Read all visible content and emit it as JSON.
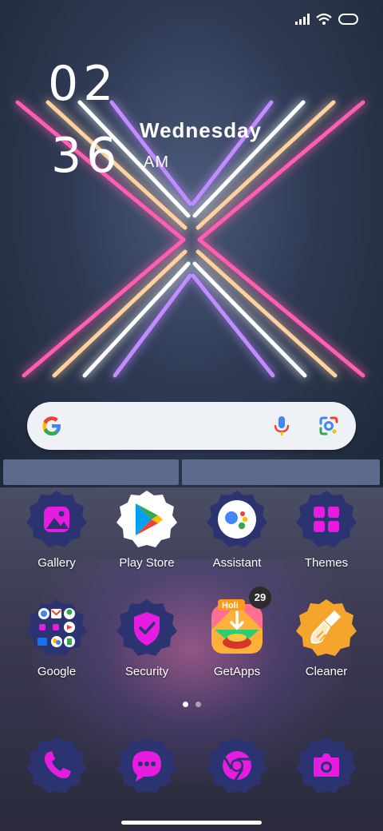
{
  "status_bar": {
    "icons": [
      "signal-icon",
      "wifi-icon",
      "battery-icon"
    ]
  },
  "clock": {
    "hour": "02",
    "minute": "36",
    "day": "Wednesday",
    "ampm": "AM"
  },
  "search": {
    "logo": "google-g-icon",
    "mic": "mic-icon",
    "lens": "google-lens-icon"
  },
  "apps": [
    {
      "label": "Gallery",
      "icon": "gallery-icon"
    },
    {
      "label": "Play Store",
      "icon": "play-store-icon"
    },
    {
      "label": "Assistant",
      "icon": "assistant-icon"
    },
    {
      "label": "Themes",
      "icon": "themes-icon"
    },
    {
      "label": "Google",
      "icon": "google-folder-icon"
    },
    {
      "label": "Security",
      "icon": "security-icon"
    },
    {
      "label": "GetApps",
      "icon": "getapps-icon",
      "badge": "29"
    },
    {
      "label": "Cleaner",
      "icon": "cleaner-icon"
    }
  ],
  "dock": [
    {
      "icon": "phone-icon"
    },
    {
      "icon": "messages-icon"
    },
    {
      "icon": "chrome-icon"
    },
    {
      "icon": "camera-icon"
    }
  ],
  "page_indicator": {
    "pages": 2,
    "active": 1
  },
  "colors": {
    "icon_bg": "#2b3470",
    "icon_glyph": "#e61ce0",
    "cleaner_bg": "#f3a52c"
  }
}
